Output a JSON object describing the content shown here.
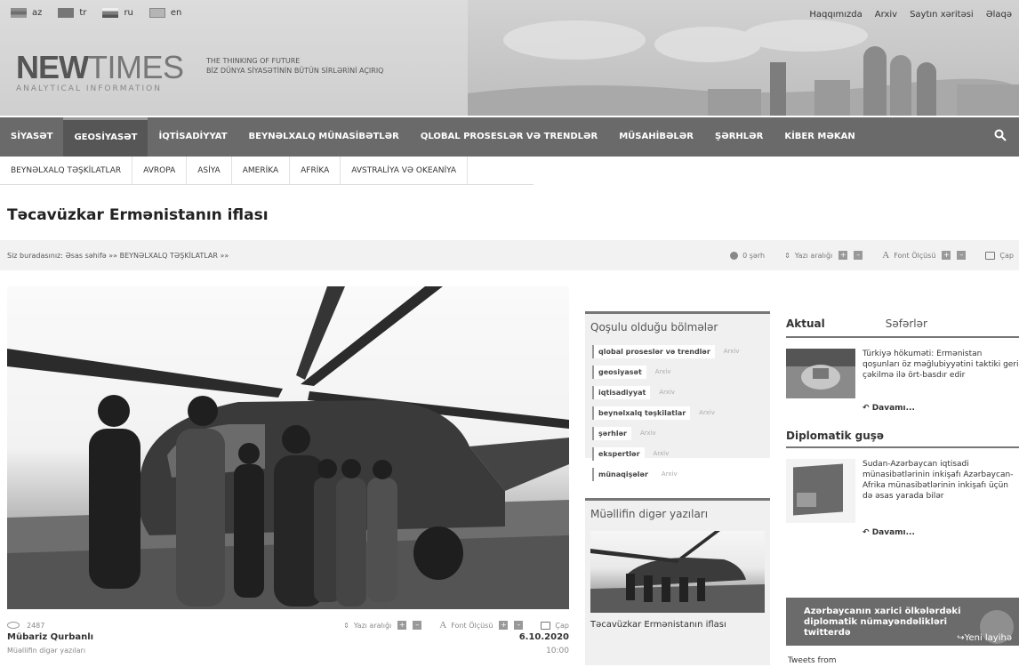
{
  "languages": [
    {
      "code": "az",
      "label": "az"
    },
    {
      "code": "tr",
      "label": "tr"
    },
    {
      "code": "ru",
      "label": "ru"
    },
    {
      "code": "en",
      "label": "en"
    }
  ],
  "top_links": [
    "Haqqımızda",
    "Arxiv",
    "Saytın xəritəsi",
    "Əlaqə"
  ],
  "logo": {
    "new": "NEW",
    "times": "TIMES",
    "sub": "ANALYTICAL INFORMATION"
  },
  "tagline": {
    "line1": "THE THINKING OF FUTURE",
    "line2": "BİZ DÜNYA SİYASƏTİNİN BÜTÜN SİRLƏRİNİ AÇIRIQ"
  },
  "main_nav": [
    "SİYASƏT",
    "GEOSİYASƏT",
    "İQTİSADİYYAT",
    "BEYNƏLXALQ MÜNASİBƏTLƏR",
    "QLOBAL PROSESLƏR VƏ TRENDLƏR",
    "MÜSAHİBƏLƏR",
    "ŞƏRHLƏR",
    "KİBER MƏKAN"
  ],
  "sub_nav": [
    "BEYNƏLXALQ TƏŞKİLATLAR",
    "AVROPA",
    "ASİYA",
    "AMERİKA",
    "AFRİKA",
    "AVSTRALİYA VƏ OKEANİYA"
  ],
  "article": {
    "title": "Təcavüzkar Ermənistanın iflası",
    "breadcrumb_prefix": "Siz buradasınız:",
    "breadcrumb_home": "Əsas səhifə",
    "breadcrumb_sep": "»»",
    "breadcrumb_cat": "BEYNƏLXALQ TƏŞKİLATLAR",
    "comments": "0 şərh",
    "line_spacing": "Yazı aralığı",
    "font_size": "Font Ölçüsü",
    "print": "Çap",
    "views": "2487",
    "author": "Mübariz Qurbanlı",
    "author_more": "Müəllifin digər yazıları",
    "date": "6.10.2020",
    "time": "10:00"
  },
  "sections_box": {
    "title": "Qoşulu olduğu bölmələr",
    "arxiv": "Arxiv",
    "tags": [
      "qlobal proseslər və trendlər",
      "geosiyasət",
      "iqtisadiyyat",
      "beynəlxalq təşkilatlar",
      "şərhlər",
      "ekspertlər",
      "münaqişələr"
    ]
  },
  "author_box": {
    "title": "Müəllifin digər yazıları",
    "caption": "Təcavüzkar Ermənistanın iflası"
  },
  "right": {
    "tab1": "Aktual",
    "tab2": "Səfərlər",
    "item1_text": "Türkiyə hökuməti: Ermənistan qoşunları öz məğlubiyyətini taktiki geri çəkilmə ilə ört-basdır edir",
    "more": "Davamı...",
    "section2": "Diplomatik guşə",
    "item2_text": "Sudan-Azərbaycan iqtisadi münasibətlərinin inkişafı Azərbaycan-Afrika münasibətlərinin inkişafı üçün də əsas yarada bilər",
    "twitter": "Azərbaycanın xarici ölkələrdəki diplomatik nümayəndəlikləri twitterdə",
    "yeni": "↪Yeni layihə",
    "tweets": "Tweets from"
  }
}
